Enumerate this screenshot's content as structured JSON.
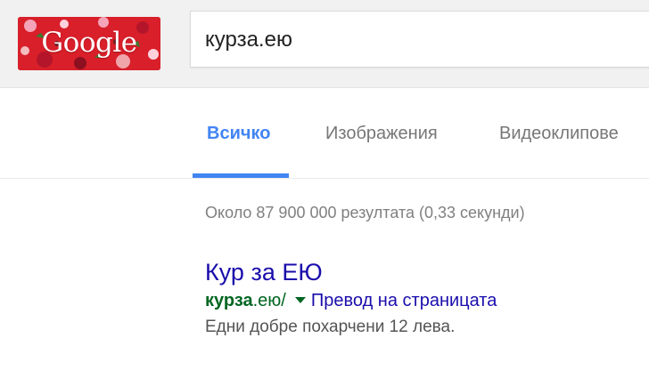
{
  "header": {
    "logo": {
      "text": "Google",
      "icon": "google-doodle-logo",
      "background": "#d81f2a"
    },
    "search": {
      "value": "курза.ею"
    }
  },
  "tabs": [
    {
      "label": "Всичко",
      "active": true
    },
    {
      "label": "Изображения",
      "active": false
    },
    {
      "label": "Видеоклипове",
      "active": false
    }
  ],
  "stats": {
    "text": "Около 87 900 000 резултата (0,33 секунди)"
  },
  "results": [
    {
      "title": "Кур за ЕЮ",
      "url_bold": "курза",
      "url_rest": ".ею/",
      "translate_label": "Превод на страницата",
      "snippet": "Едни добре похарчени 12 лева."
    }
  ],
  "colors": {
    "accent": "#4285f4",
    "link": "#1a0dab",
    "url": "#006621",
    "muted": "#808080"
  }
}
